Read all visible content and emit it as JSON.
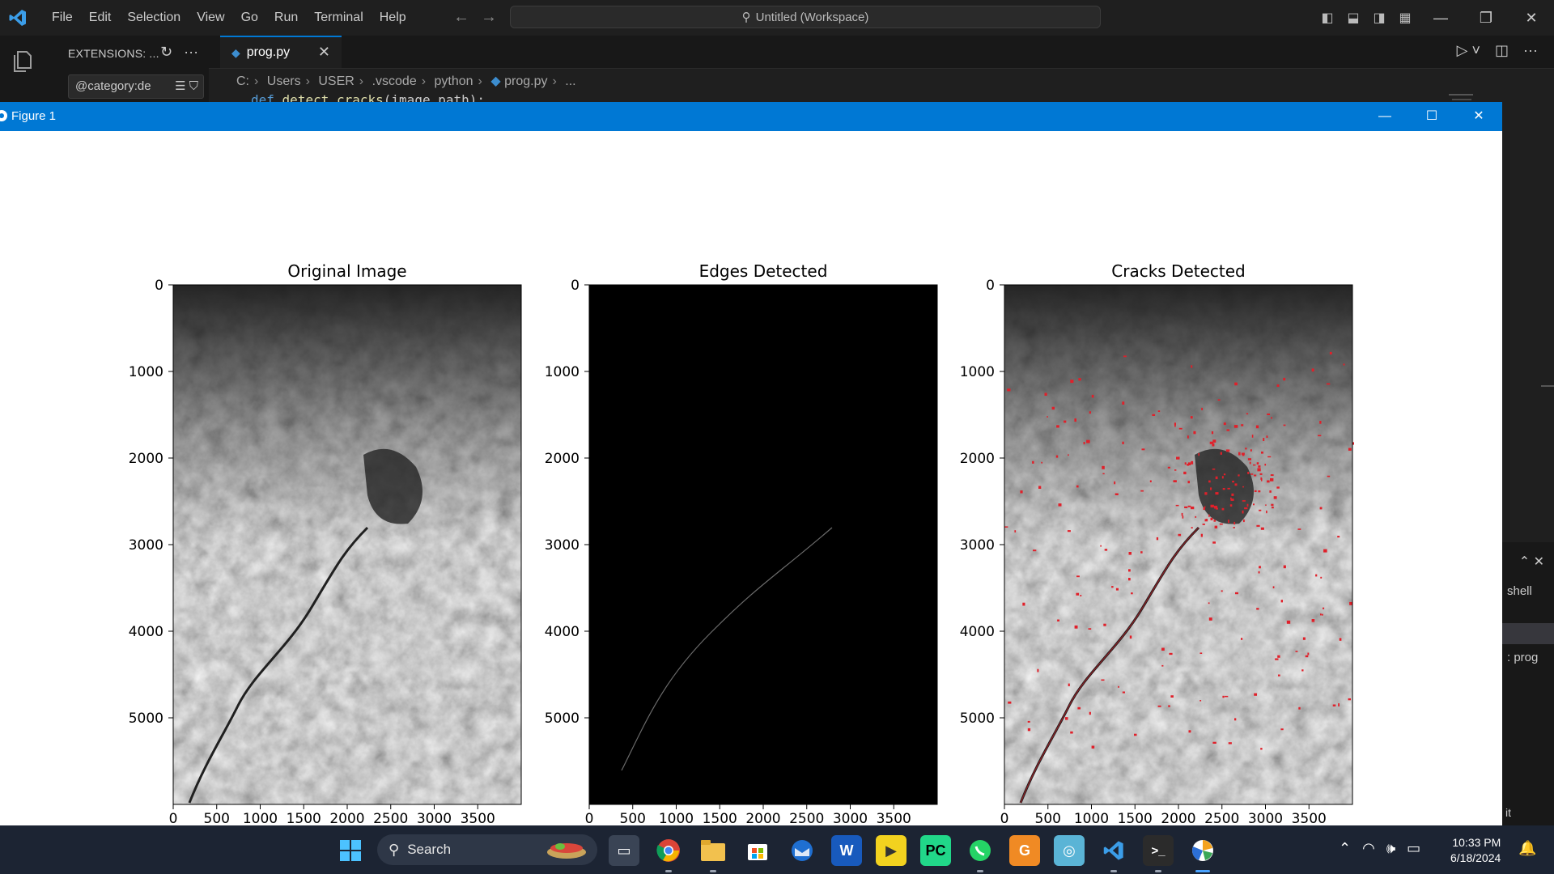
{
  "vscode": {
    "menu": [
      "File",
      "Edit",
      "Selection",
      "View",
      "Go",
      "Run",
      "Terminal",
      "Help"
    ],
    "command_center": "Untitled (Workspace)",
    "sidebar_title": "EXTENSIONS: ...",
    "sidebar_search_value": "@category:de",
    "tab_label": "prog.py",
    "breadcrumb": [
      "C:",
      "Users",
      "USER",
      ".vscode",
      "python",
      "prog.py",
      "..."
    ],
    "code_peek": {
      "keyword": "def",
      "function": "detect_cracks",
      "params": "(image_path):"
    },
    "panel": {
      "shell_label": "shell",
      "terminal_item": ": prog",
      "bottom_text": "it"
    }
  },
  "figure": {
    "window_title": "Figure 1",
    "panels": [
      {
        "title": "Original Image"
      },
      {
        "title": "Edges Detected"
      },
      {
        "title": "Cracks Detected"
      }
    ],
    "colors": {
      "titlebar": "#0078d4",
      "crack_overlay": "#e0202a"
    }
  },
  "chart_data": [
    {
      "type": "image",
      "title": "Original Image",
      "xticks": [
        0,
        500,
        1000,
        1500,
        2000,
        2500,
        3000,
        3500
      ],
      "yticks": [
        0,
        1000,
        2000,
        3000,
        4000,
        5000
      ],
      "xlim": [
        0,
        4000
      ],
      "ylim": [
        6000,
        0
      ]
    },
    {
      "type": "image",
      "title": "Edges Detected",
      "xticks": [
        0,
        500,
        1000,
        1500,
        2000,
        2500,
        3000,
        3500
      ],
      "yticks": [
        0,
        1000,
        2000,
        3000,
        4000,
        5000
      ],
      "xlim": [
        0,
        4000
      ],
      "ylim": [
        6000,
        0
      ]
    },
    {
      "type": "image",
      "title": "Cracks Detected",
      "xticks": [
        0,
        500,
        1000,
        1500,
        2000,
        2500,
        3000,
        3500
      ],
      "yticks": [
        0,
        1000,
        2000,
        3000,
        4000,
        5000
      ],
      "xlim": [
        0,
        4000
      ],
      "ylim": [
        6000,
        0
      ]
    }
  ],
  "taskbar": {
    "search_label": "Search",
    "apps": [
      "task-view",
      "chrome",
      "file-explorer",
      "microsoft-store",
      "thunderbird",
      "word",
      "potplayer",
      "pycharm",
      "whatsapp",
      "pdf-editor",
      "app-blue",
      "vscode",
      "terminal",
      "figure-app"
    ],
    "time": "10:33 PM",
    "date": "6/18/2024"
  }
}
